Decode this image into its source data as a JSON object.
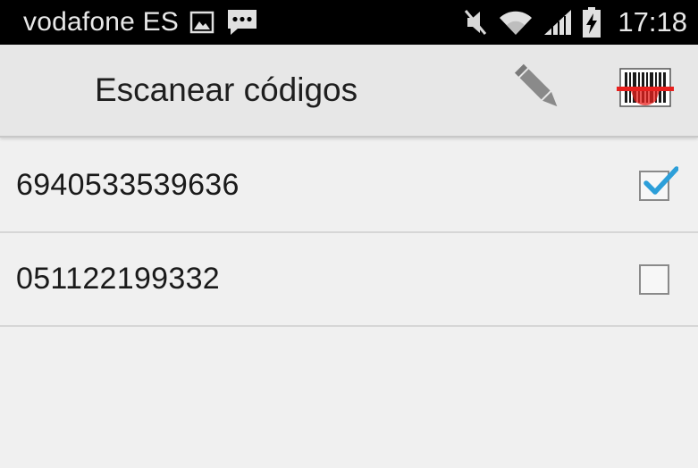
{
  "status_bar": {
    "carrier": "vodafone ES",
    "time": "17:18",
    "icons": [
      "image-notification-icon",
      "chat-notification-icon",
      "mute-icon",
      "wifi-icon",
      "signal-icon",
      "battery-charging-icon"
    ]
  },
  "action_bar": {
    "title": "Escanear códigos",
    "icons": [
      "pencil-icon",
      "barcode-scan-icon"
    ],
    "accent_color": "#e8201e"
  },
  "codes": [
    {
      "value": "6940533539636",
      "checked": true
    },
    {
      "value": "051122199332",
      "checked": false
    }
  ],
  "colors": {
    "check": "#2d9fd9",
    "background": "#f0f0f0",
    "action_bar": "#e7e7e7"
  }
}
